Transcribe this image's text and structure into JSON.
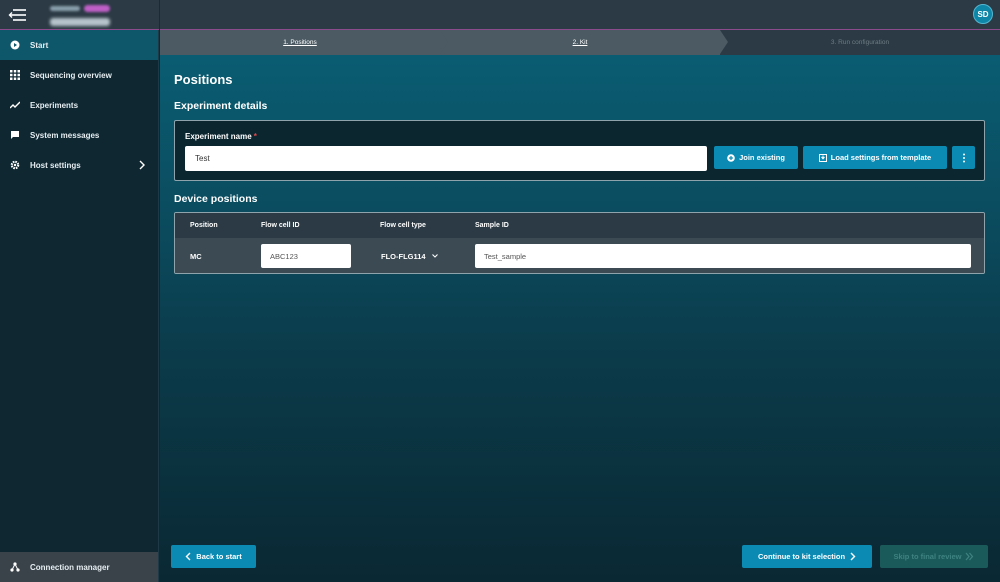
{
  "header": {
    "host_label": "minion",
    "host_badge": "remote",
    "host_name": "gxb01234",
    "avatar_initials": "SD"
  },
  "sidebar": {
    "items": [
      {
        "label": "Start",
        "icon": "play-circle-icon",
        "active": true
      },
      {
        "label": "Sequencing overview",
        "icon": "grid-icon"
      },
      {
        "label": "Experiments",
        "icon": "trend-line-icon"
      },
      {
        "label": "System messages",
        "icon": "message-icon"
      },
      {
        "label": "Host settings",
        "icon": "gear-icon",
        "has_submenu": true
      }
    ],
    "bottom": {
      "label": "Connection manager",
      "icon": "network-icon"
    }
  },
  "stepper": {
    "steps": [
      {
        "label": "1. Positions",
        "state": "completed"
      },
      {
        "label": "2. Kit",
        "state": "completed"
      },
      {
        "label": "3. Run configuration",
        "state": "disabled"
      }
    ]
  },
  "page": {
    "title": "Positions",
    "experiment_details_heading": "Experiment details",
    "experiment_name_label": "Experiment name",
    "required_marker": "*",
    "experiment_name_value": "Test",
    "join_existing_label": "Join existing",
    "load_settings_label": "Load settings from template",
    "device_positions_heading": "Device positions"
  },
  "table": {
    "headers": [
      "Position",
      "Flow cell ID",
      "Flow cell type",
      "Sample ID"
    ],
    "rows": [
      {
        "position": "MC",
        "flow_cell_id": "ABC123",
        "flow_cell_type": "FLO-FLG114",
        "sample_id": "Test_sample"
      }
    ]
  },
  "footer": {
    "back_label": "Back to start",
    "continue_label": "Continue to kit selection",
    "skip_label": "Skip to final review"
  },
  "colors": {
    "accent": "#0b8ab3",
    "sidebar_active": "#0e5669",
    "required": "#e04a4a",
    "topbar_border": "#8c4b8c"
  }
}
